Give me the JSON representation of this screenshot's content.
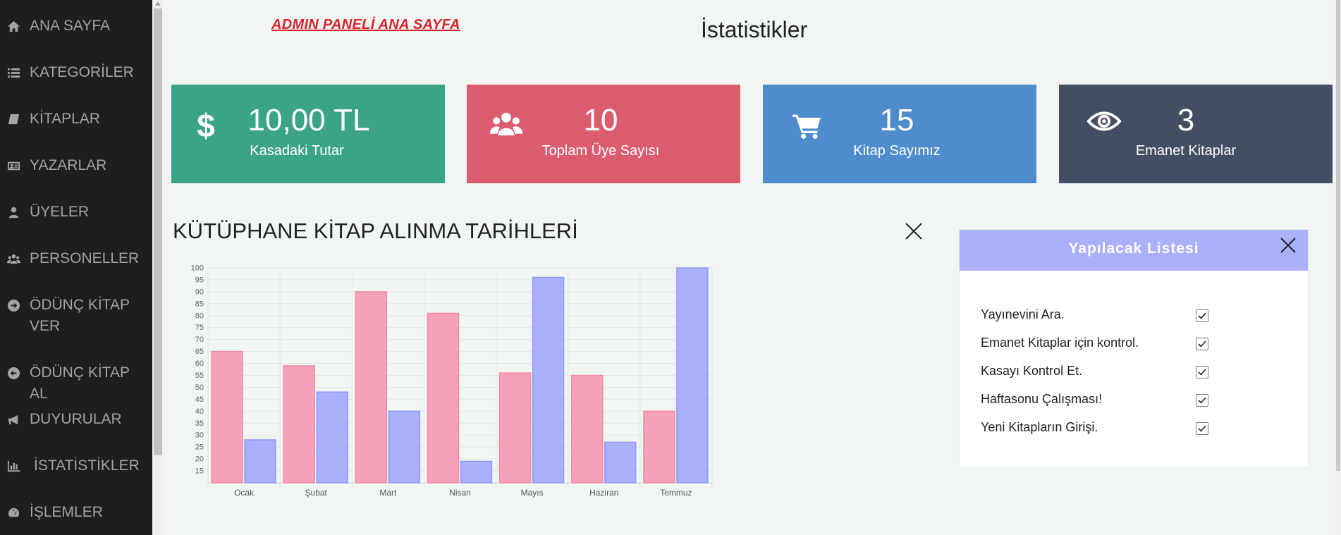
{
  "sidebar": {
    "items": [
      {
        "label": "ANA SAYFA",
        "icon": "home-icon"
      },
      {
        "label": "KATEGORİLER",
        "icon": "list-icon"
      },
      {
        "label": "KİTAPLAR",
        "icon": "book-icon"
      },
      {
        "label": "YAZARLAR",
        "icon": "id-card-icon"
      },
      {
        "label": "ÜYELER",
        "icon": "user-icon"
      },
      {
        "label": "PERSONELLER",
        "icon": "users-icon"
      },
      {
        "label": "ÖDÜNÇ KİTAP VER",
        "icon": "arrow-circle-right-icon"
      },
      {
        "label": "ÖDÜNÇ KİTAP AL",
        "icon": "arrow-circle-left-icon"
      },
      {
        "label": "DUYURULAR",
        "icon": "bullhorn-icon"
      },
      {
        "label": "İSTATİSTİKLER",
        "icon": "bar-chart-icon"
      },
      {
        "label": "İŞLEMLER",
        "icon": "dashboard-icon"
      }
    ]
  },
  "header": {
    "admin_title": "ADMIN PANELİ ANA SAYFA",
    "page_title": "İstatistikler"
  },
  "cards": [
    {
      "value": "10,00 TL",
      "label": "Kasadaki Tutar",
      "icon": "dollar-icon",
      "color": "#3ba386"
    },
    {
      "value": "10",
      "label": "Toplam Üye Sayısı",
      "icon": "users-icon",
      "color": "#db5c6f"
    },
    {
      "value": "15",
      "label": "Kitap Sayımız",
      "icon": "cart-icon",
      "color": "#4f8ccc"
    },
    {
      "value": "3",
      "label": "Emanet Kitaplar",
      "icon": "eye-icon",
      "color": "#444e63"
    }
  ],
  "chart_section": {
    "title": "KÜTÜPHANE KİTAP ALINMA TARİHLERİ"
  },
  "chart_data": {
    "type": "bar",
    "categories": [
      "Ocak",
      "Şubat",
      "Mart",
      "Nisan",
      "Mayıs",
      "Haziran",
      "Temmuz"
    ],
    "series": [
      {
        "values": [
          65,
          59,
          90,
          81,
          56,
          55,
          40
        ],
        "color": "#f5a1b8"
      },
      {
        "values": [
          28,
          48,
          40,
          19,
          96,
          27,
          100
        ],
        "color": "#aab0fb"
      }
    ],
    "yticks": [
      15,
      20,
      25,
      30,
      35,
      40,
      45,
      50,
      55,
      60,
      65,
      70,
      75,
      80,
      85,
      90,
      95,
      100
    ],
    "ylim": [
      10,
      100
    ],
    "grid": true
  },
  "todo": {
    "title": "Yapılacak Listesi",
    "items": [
      {
        "label": "Yayınevini Ara.",
        "checked": true
      },
      {
        "label": "Emanet Kitaplar için kontrol.",
        "checked": true
      },
      {
        "label": "Kasayı Kontrol Et.",
        "checked": true
      },
      {
        "label": "Haftasonu Çalışması!",
        "checked": true
      },
      {
        "label": "Yeni Kitapların Girişi.",
        "checked": true
      }
    ]
  }
}
